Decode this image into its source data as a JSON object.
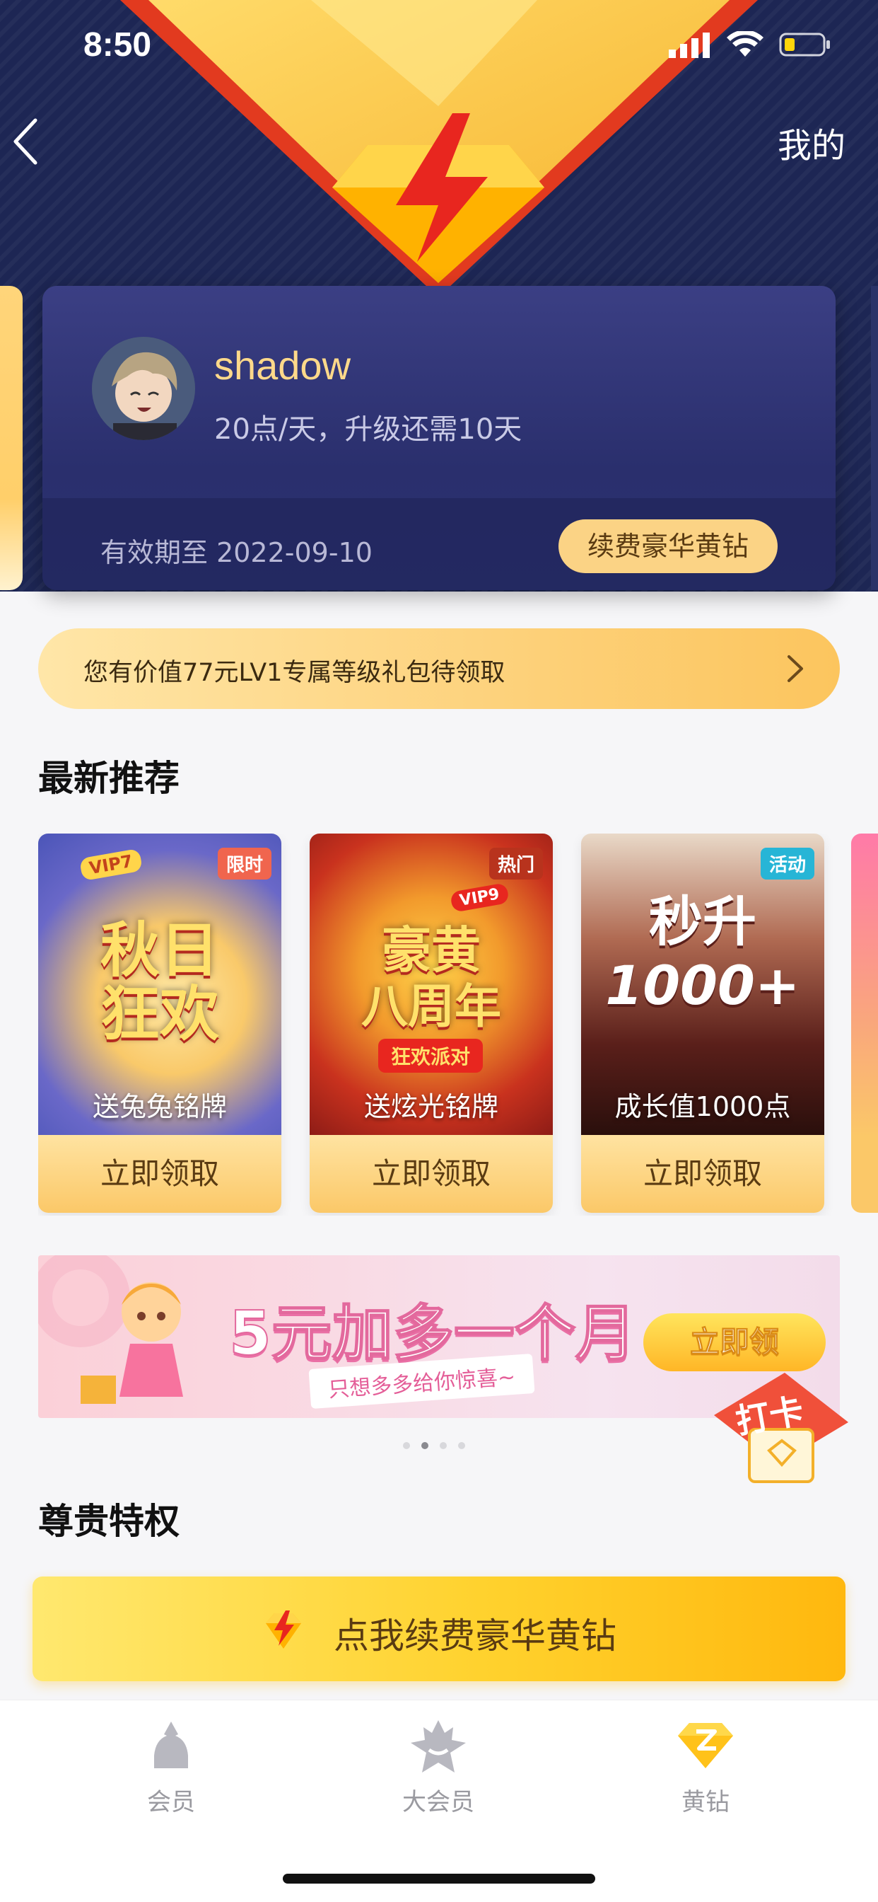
{
  "status_bar": {
    "time": "8:50"
  },
  "nav": {
    "right_label": "我的"
  },
  "member_card": {
    "username": "shadow",
    "level_info": "20点/天，升级还需10天",
    "expiry": "有效期至 2022-09-10",
    "renew_button": "续费豪华黄钻"
  },
  "gift_banner": {
    "text": "您有价值77元LV1专属等级礼包待领取"
  },
  "recommend": {
    "title": "最新推荐",
    "items": [
      {
        "tag": "限时",
        "tag_color": "#f0654e",
        "art_lines": [
          "秋日",
          "狂欢"
        ],
        "badge": "VIP7",
        "caption": "送兔兔铭牌",
        "button": "立即领取"
      },
      {
        "tag": "热门",
        "tag_color": "#b8331d",
        "art_lines": [
          "豪黄",
          "八周年"
        ],
        "banner": "狂欢派对",
        "badge": "VIP9",
        "caption": "送炫光铭牌",
        "button": "立即领取"
      },
      {
        "tag": "活动",
        "tag_color": "#27b5d6",
        "art_lines": [
          "秒升",
          "1000+"
        ],
        "caption": "成长值1000点",
        "button": "立即领取"
      }
    ]
  },
  "promo_banner": {
    "headline": "5元加多一个月",
    "subline": "只想多多给你惊喜~",
    "button": "立即领",
    "stamp": "打卡",
    "page_count": 4,
    "active_index": 1
  },
  "privileges": {
    "title": "尊贵特权",
    "renew_bar": "点我续费豪华黄钻"
  },
  "tabbar": {
    "items": [
      {
        "label": "会员",
        "icon": "member-icon",
        "active": false
      },
      {
        "label": "大会员",
        "icon": "big-member-icon",
        "active": false
      },
      {
        "label": "黄钻",
        "icon": "yellow-diamond-icon",
        "active": true
      }
    ]
  },
  "colors": {
    "brand_yellow": "#ffc93c",
    "card_navy": "#2a2f6d",
    "accent_orange": "#fbc868"
  }
}
